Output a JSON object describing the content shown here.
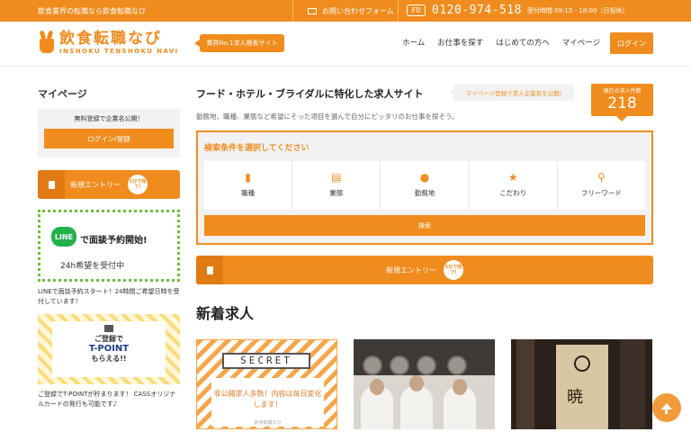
{
  "topbar": {
    "tagline": "飲食業界の転職なら飲食転職なび",
    "contact_label": "お問い合わせフォーム",
    "freedial_label": "FD",
    "phone": "0120-974-518",
    "hours": "受付時間 09:15 - 18:00（日祝休）"
  },
  "header": {
    "logo_jp": "飲食転職なび",
    "logo_en": "INSHOKU TENSHOKU NAVI",
    "badge": "業界No.1求人検索サイト",
    "nav": [
      "ホーム",
      "お仕事を探す",
      "はじめての方へ",
      "マイページ"
    ],
    "login": "ログイン"
  },
  "sidebar": {
    "title": "マイページ",
    "box_text": "無料登録で企業名公開！",
    "box_button": "ログイン/登録",
    "entry_label": "新規エントリー",
    "entry_badge": "1分で完了!",
    "line_logo": "LINE",
    "line_big": "で面談予約開始!",
    "line_sub": "24h希望を受付中",
    "line_caption": "LINEで面談予約スタート！24時間ご希望日時を受付しています！",
    "tpoint_t1": "ご登録で",
    "tpoint_t2": "T-POINT",
    "tpoint_t3": "もらえる!!",
    "tpoint_caption": "ご登録でT-POINTが貯まります！ CASSオリジナルカードの発行も可能です♪"
  },
  "main": {
    "title": "フード・ホテル・ブライダルに特化した求人サイト",
    "pill": "マイページ登録で求人企業名を公開!",
    "count_label": "現在の求人件数",
    "count_value": "218",
    "description": "勤務地、職種、業態など希望にそった項目を選んで自分にピッタリのお仕事を探そう。",
    "search_label": "検索条件を選択してください",
    "categories": [
      {
        "label": "職種",
        "icon": "badge-icon"
      },
      {
        "label": "業態",
        "icon": "building-icon"
      },
      {
        "label": "勤務地",
        "icon": "pin-icon"
      },
      {
        "label": "こだわり",
        "icon": "star-icon"
      },
      {
        "label": "フリーワード",
        "icon": "search-icon"
      }
    ],
    "search_button": "検索",
    "entry_label": "新規エントリー",
    "entry_badge": "1分で完了!",
    "new_title": "新着求人",
    "secret_plate": "SECRET",
    "secret_msg": "非公開求人多数！内容は毎日変化します！",
    "secret_small": "飲食転職なび",
    "kanji": "暁"
  },
  "colors": {
    "accent": "#f08c1e",
    "line_green": "#23b14d"
  }
}
